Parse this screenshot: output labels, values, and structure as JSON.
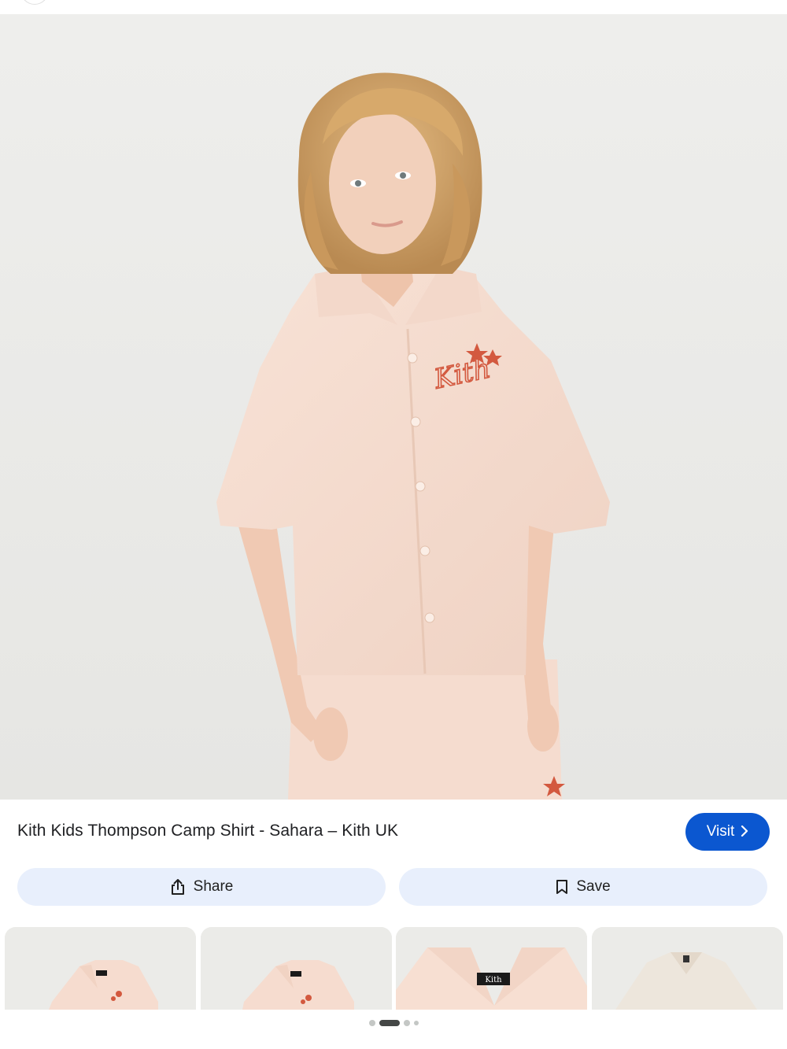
{
  "result": {
    "title": "Kith Kids Thompson Camp Shirt - Sahara – Kith UK",
    "visit_label": "Visit",
    "chest_logo_text": "Kith",
    "image_description_icon": "product-photo"
  },
  "actions": {
    "share_label": "Share",
    "save_label": "Save"
  },
  "thumbnails": [
    {
      "name": "thumbnail-1",
      "tag_text": "Kith"
    },
    {
      "name": "thumbnail-2",
      "tag_text": "Kith"
    },
    {
      "name": "thumbnail-3",
      "tag_text": "Kith"
    },
    {
      "name": "thumbnail-4",
      "tag_text": ""
    }
  ],
  "pagination": {
    "count": 4,
    "active_index": 1
  },
  "colors": {
    "accent": "#0b57d0",
    "pill_bg": "#e8effc",
    "shirt": "#f6ddd0",
    "logo": "#d3593f",
    "backdrop": "#ebebe8"
  }
}
